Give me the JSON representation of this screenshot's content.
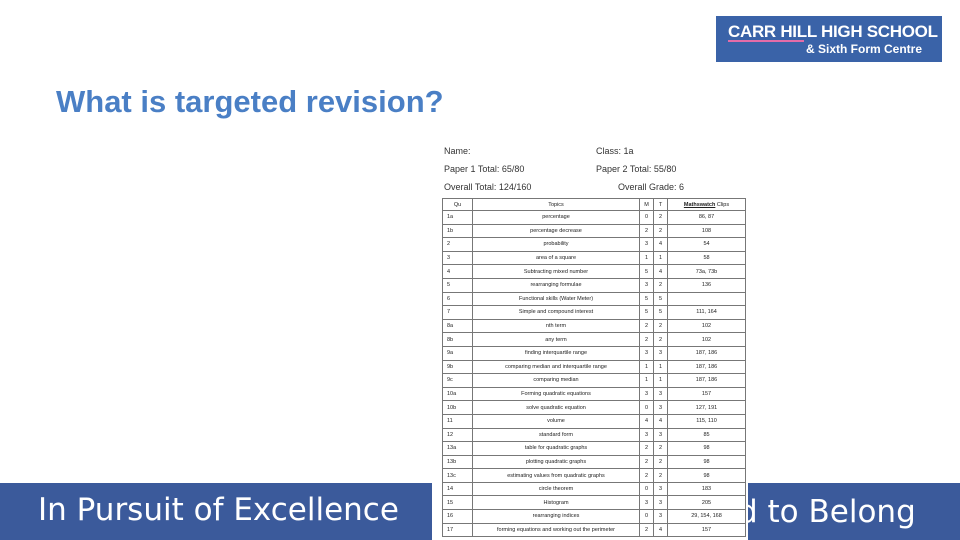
{
  "logo": {
    "line1": "CARR HILL HIGH SCHOOL",
    "line2": "& Sixth Form Centre"
  },
  "title": "What is targeted revision?",
  "footer": {
    "left": "In Pursuit of Excellence",
    "right": "d to Belong"
  },
  "sheet": {
    "name_label": "Name:",
    "class_label": "Class: 1a",
    "paper1": "Paper 1 Total: 65/80",
    "paper2": "Paper 2 Total: 55/80",
    "overall_total": "Overall Total: 124/160",
    "overall_grade": "Overall Grade: 6",
    "columns": [
      "Qu",
      "Topics",
      "M",
      "T",
      "Mathswatch",
      "Clips"
    ],
    "rows": [
      [
        "1a",
        "percentage",
        "0",
        "2",
        "86, 87"
      ],
      [
        "1b",
        "percentage decrease",
        "2",
        "2",
        "108"
      ],
      [
        "2",
        "probability",
        "3",
        "4",
        "54"
      ],
      [
        "3",
        "area of a square",
        "1",
        "1",
        "58"
      ],
      [
        "4",
        "Subtracting mixed number",
        "5",
        "4",
        "73a, 73b"
      ],
      [
        "5",
        "rearranging formulae",
        "3",
        "2",
        "136"
      ],
      [
        "6",
        "Functional skills (Water Meter)",
        "5",
        "5",
        ""
      ],
      [
        "7",
        "Simple and compound interest",
        "5",
        "5",
        "111, 164"
      ],
      [
        "8a",
        "nth term",
        "2",
        "2",
        "102"
      ],
      [
        "8b",
        "any term",
        "2",
        "2",
        "102"
      ],
      [
        "9a",
        "finding interquartile range",
        "3",
        "3",
        "187, 186"
      ],
      [
        "9b",
        "comparing median and interquartile range",
        "1",
        "1",
        "187, 186"
      ],
      [
        "9c",
        "comparing median",
        "1",
        "1",
        "187, 186"
      ],
      [
        "10a",
        "Forming quadratic equations",
        "3",
        "3",
        "157"
      ],
      [
        "10b",
        "solve quadratic equation",
        "0",
        "3",
        "127, 191"
      ],
      [
        "11",
        "volume",
        "4",
        "4",
        "115, 110"
      ],
      [
        "12",
        "standard form",
        "3",
        "3",
        "85"
      ],
      [
        "13a",
        "table for quadratic graphs",
        "2",
        "2",
        "98"
      ],
      [
        "13b",
        "plotting quadratic graphs",
        "2",
        "2",
        "98"
      ],
      [
        "13c",
        "estimating values from quadratic graphs",
        "2",
        "2",
        "98"
      ],
      [
        "14",
        "circle theorem",
        "0",
        "3",
        "183"
      ],
      [
        "15",
        "Histogram",
        "3",
        "3",
        "205"
      ],
      [
        "16",
        "rearranging indices",
        "0",
        "3",
        "29, 154, 168"
      ],
      [
        "17",
        "forming equations and working out the perimeter",
        "2",
        "4",
        "157"
      ]
    ]
  }
}
